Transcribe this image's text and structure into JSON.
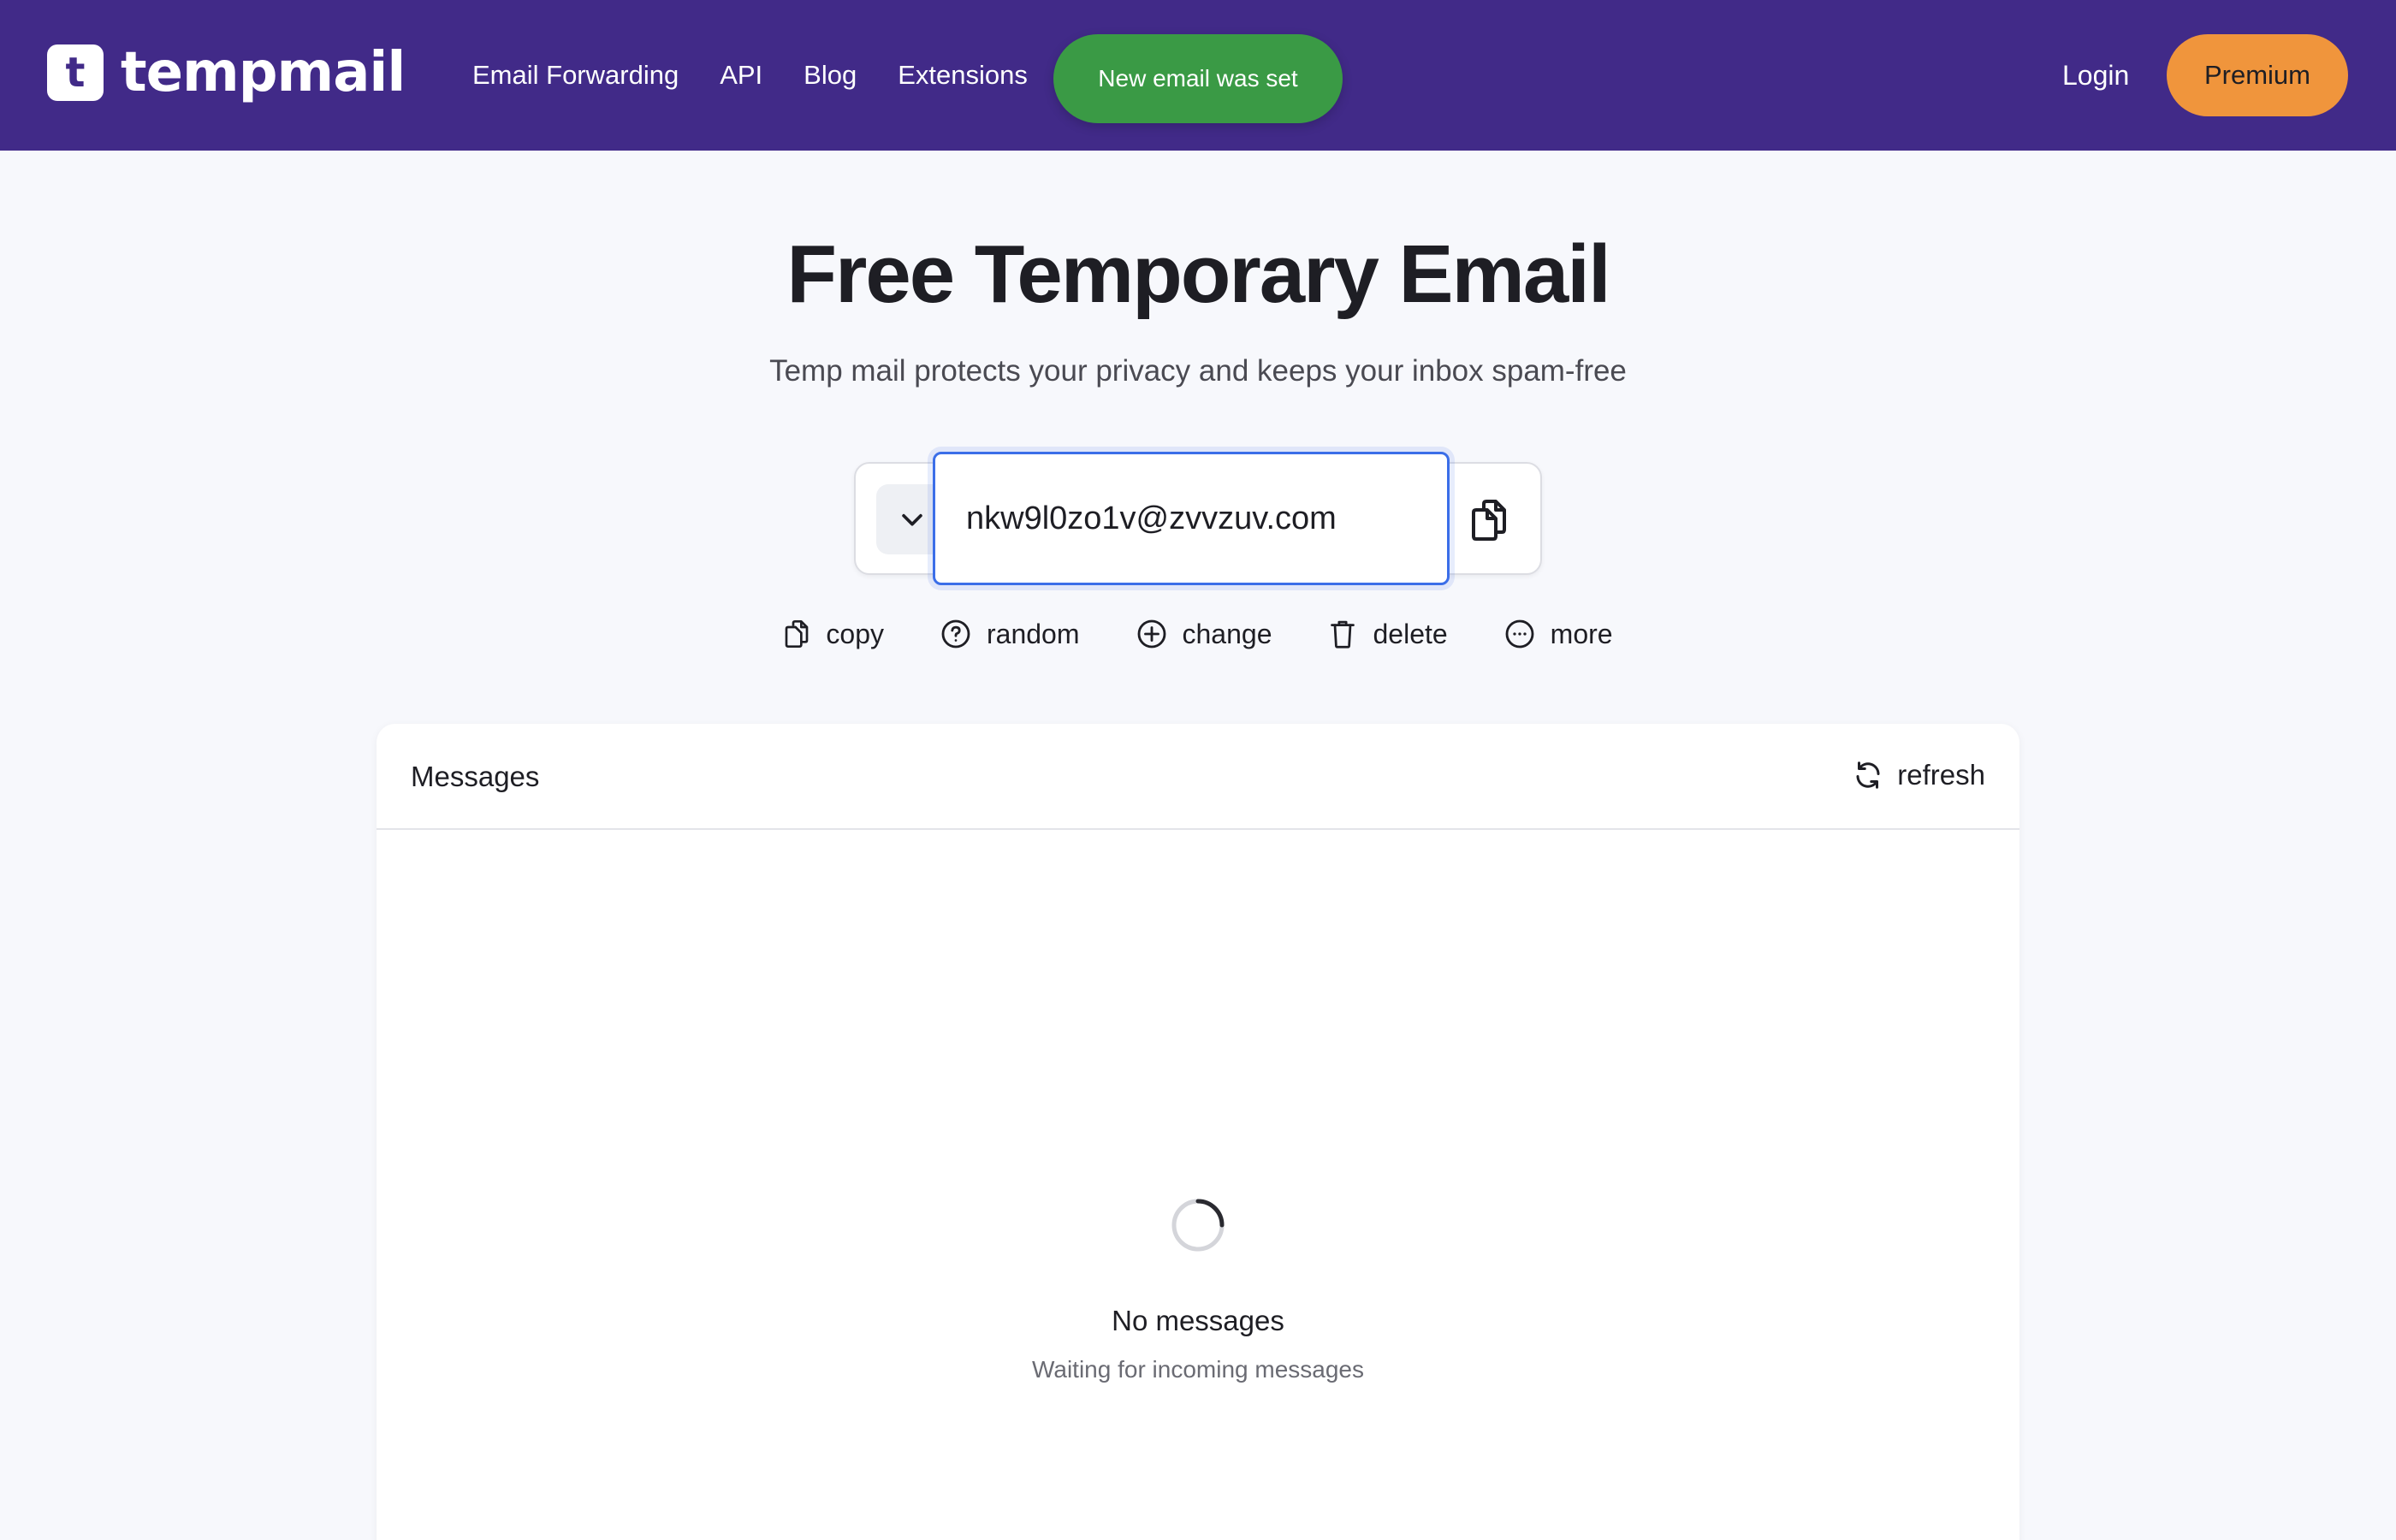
{
  "header": {
    "logo_letter": "t",
    "logo_text": "tempmail",
    "nav": [
      {
        "label": "Email Forwarding"
      },
      {
        "label": "API"
      },
      {
        "label": "Blog"
      },
      {
        "label": "Extensions"
      }
    ],
    "toast": "New email was set",
    "login_label": "Login",
    "premium_label": "Premium",
    "colors": {
      "header_bg": "#412a88",
      "toast_bg": "#3a9a45",
      "premium_bg": "#f0953c"
    }
  },
  "hero": {
    "title": "Free Temporary Email",
    "subtitle": "Temp mail protects your privacy and keeps your inbox spam-free"
  },
  "email": {
    "value": "nkw9l0zo1v@zvvzuv.com",
    "toggle_icon": "chevron-down-icon",
    "copy_icon": "copy-icon"
  },
  "actions": [
    {
      "label": "copy",
      "icon": "copy-icon"
    },
    {
      "label": "random",
      "icon": "question-circle-icon"
    },
    {
      "label": "change",
      "icon": "plus-circle-icon"
    },
    {
      "label": "delete",
      "icon": "trash-icon"
    },
    {
      "label": "more",
      "icon": "more-circle-icon"
    }
  ],
  "messages": {
    "title": "Messages",
    "refresh_label": "refresh",
    "empty_title": "No messages",
    "empty_subtitle": "Waiting for incoming messages"
  }
}
